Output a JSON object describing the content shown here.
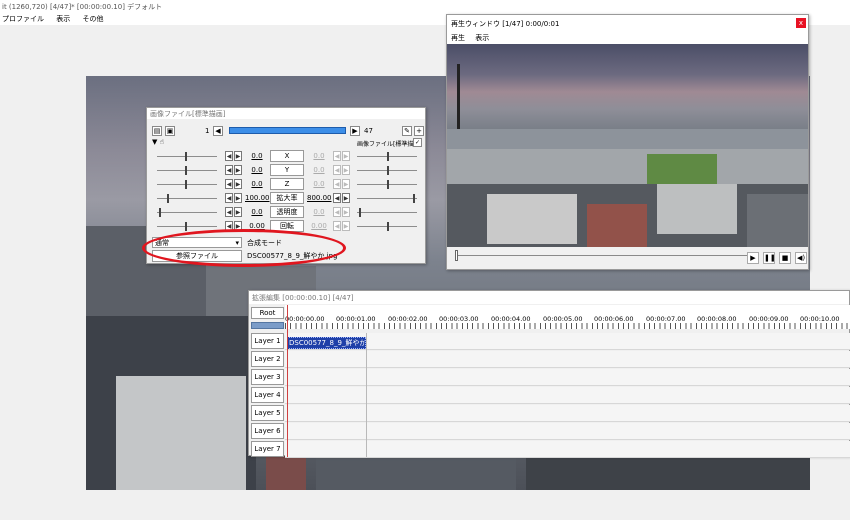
{
  "main_window": {
    "title": "it (1260,720)  [4/47]* [00:00:00.10]  デフォルト",
    "menu": [
      "プロファイル",
      "表示",
      "その他"
    ]
  },
  "playback_window": {
    "title": "再生ウィンドウ  [1/47]  0:00/0:01",
    "close_label": "x",
    "menu": [
      "再生",
      "表示"
    ],
    "buttons": {
      "play": "▶",
      "pause": "❚❚",
      "stop": "■",
      "volume": "◀)"
    }
  },
  "image_dialog": {
    "title": "画像ファイル[標準描画]",
    "frame_start": "1",
    "frame_end": "47",
    "checkbox_label": "画像ファイル[標準描画]",
    "params": [
      {
        "label": "X",
        "value": "0.0",
        "value2": "0.0"
      },
      {
        "label": "Y",
        "value": "0.0",
        "value2": "0.0"
      },
      {
        "label": "Z",
        "value": "0.0",
        "value2": "0.0"
      },
      {
        "label": "拡大率",
        "value": "100.00",
        "value2": "800.00"
      },
      {
        "label": "透明度",
        "value": "0.0",
        "value2": "0.0"
      },
      {
        "label": "回転",
        "value": "0.00",
        "value2": "0.00"
      }
    ],
    "blend_mode": "通常",
    "blend_label": "合成モード",
    "ref_button": "参照ファイル",
    "file_name": "DSC00577_8_9_鮮やか.jpg"
  },
  "timeline": {
    "title": "拡張編集 [00:00:00.10] [4/47]",
    "root_label": "Root",
    "ruler": [
      "00:00:00.00",
      "00:00:01.00",
      "00:00:02.00",
      "00:00:03.00",
      "00:00:04.00",
      "00:00:05.00",
      "00:00:06.00",
      "00:00:07.00",
      "00:00:08.00",
      "00:00:09.00",
      "00:00:10.00"
    ],
    "layers": [
      "Layer 1",
      "Layer 2",
      "Layer 3",
      "Layer 4",
      "Layer 5",
      "Layer 6",
      "Layer 7"
    ],
    "clip_label": "DSC00577_8_9_鮮やか.jpg"
  },
  "colors": {
    "clip": "#1e3fa8",
    "annotation": "#e0161f",
    "frame_bar": "#3c8ee8",
    "cursor": "#d04040"
  }
}
